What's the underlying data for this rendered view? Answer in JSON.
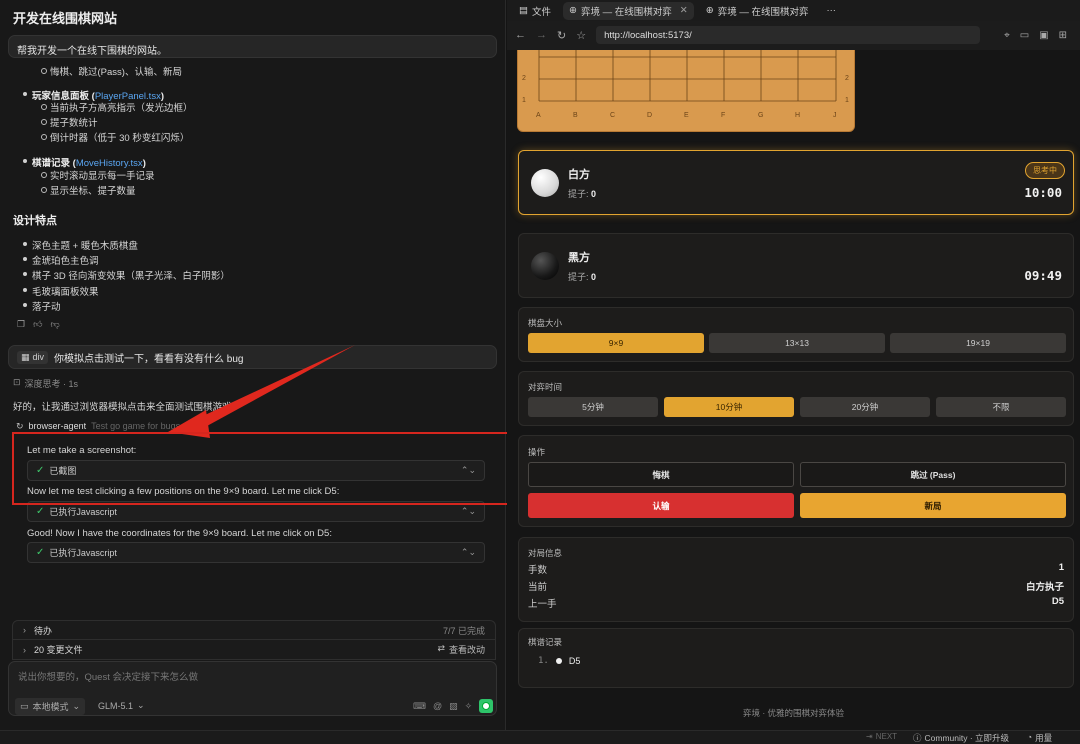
{
  "chat": {
    "title": "开发在线围棋网站",
    "user_msg1": "帮我开发一个在线下围棋的网站。",
    "bullets": {
      "line0": "悔棋、跳过(Pass)、认输、新局",
      "player_panel_label": "玩家信息面板 (",
      "player_panel_file": "PlayerPanel.tsx",
      "player_panel_close": ")",
      "player_sub": [
        "当前执子方高亮指示（发光边框）",
        "提子数统计",
        "倒计时器（低于 30 秒变红闪烁）"
      ],
      "history_label": "棋谱记录 (",
      "history_file": "MoveHistory.tsx",
      "history_close": ")",
      "history_sub": [
        "实时滚动显示每一手记录",
        "显示坐标、提子数量"
      ]
    },
    "design_title": "设计特点",
    "design_items": [
      "深色主题 + 暖色木质棋盘",
      "金琥珀色主色调",
      "棋子 3D 径向渐变效果（黑子光泽、白子阴影）",
      "毛玻璃面板效果",
      "落子动"
    ],
    "user_msg2_chip": "div",
    "user_msg2": "你模拟点击测试一下，看看有没有什么 bug",
    "thinking": "深度思考 · 1s",
    "reply": "好的，让我通过浏览器模拟点击来全面测试围棋游戏",
    "agent_name": "browser-agent",
    "agent_task": "Test go game for bugs",
    "log1": "Let me take a screenshot:",
    "tool1": "已截图",
    "log2": "Now let me test clicking a few positions on the 9×9 board. Let me click D5:",
    "tool2": "已执行Javascript",
    "log3": "Good! Now I have the coordinates for the 9×9 board. Let me click on D5:",
    "tool3": "已执行Javascript",
    "todo_label": "待办",
    "todo_status": "7/7 已完成",
    "files_label": "20 变更文件",
    "files_action": "查看改动",
    "composer_placeholder": "说出你想要的，Quest 会决定接下来怎么做",
    "mode": "本地模式",
    "model": "GLM-5.1"
  },
  "status": {
    "next": "NEXT",
    "community": "Community · 立即升级",
    "usage": "用量"
  },
  "browser": {
    "tabs": [
      "文件",
      "弈境 — 在线围棋对弈",
      "弈境 — 在线围棋对弈"
    ],
    "more": "···",
    "url": "http://localhost:5173/"
  },
  "board": {
    "col_labels": [
      "A",
      "B",
      "C",
      "D",
      "E",
      "F",
      "G",
      "H",
      "J"
    ],
    "row_labels": [
      "2",
      "1"
    ]
  },
  "players": {
    "white": {
      "name": "白方",
      "captures_label": "提子:",
      "captures": "0",
      "status": "思考中",
      "time": "10:00"
    },
    "black": {
      "name": "黑方",
      "captures_label": "提子:",
      "captures": "0",
      "time": "09:49"
    }
  },
  "board_size": {
    "label": "棋盘大小",
    "options": [
      "9×9",
      "13×13",
      "19×19"
    ]
  },
  "time_control": {
    "label": "对弈时间",
    "options": [
      "5分钟",
      "10分钟",
      "20分钟",
      "不限"
    ]
  },
  "actions": {
    "label": "操作",
    "undo": "悔棋",
    "pass": "跳过 (Pass)",
    "resign": "认输",
    "new_game": "新局"
  },
  "game_info": {
    "label": "对局信息",
    "moves_label": "手数",
    "moves": "1",
    "current_label": "当前",
    "current": "白方执子",
    "last_label": "上一手",
    "last": "D5"
  },
  "record": {
    "label": "棋谱记录",
    "entries": [
      {
        "num": "1.",
        "move": "D5"
      }
    ]
  },
  "footer": "弈境 · 优雅的围棋对弈体验",
  "colors": {
    "accent": "#e2a430",
    "danger": "#d73030",
    "board": "#d99a4e",
    "callout": "#d6261e"
  }
}
